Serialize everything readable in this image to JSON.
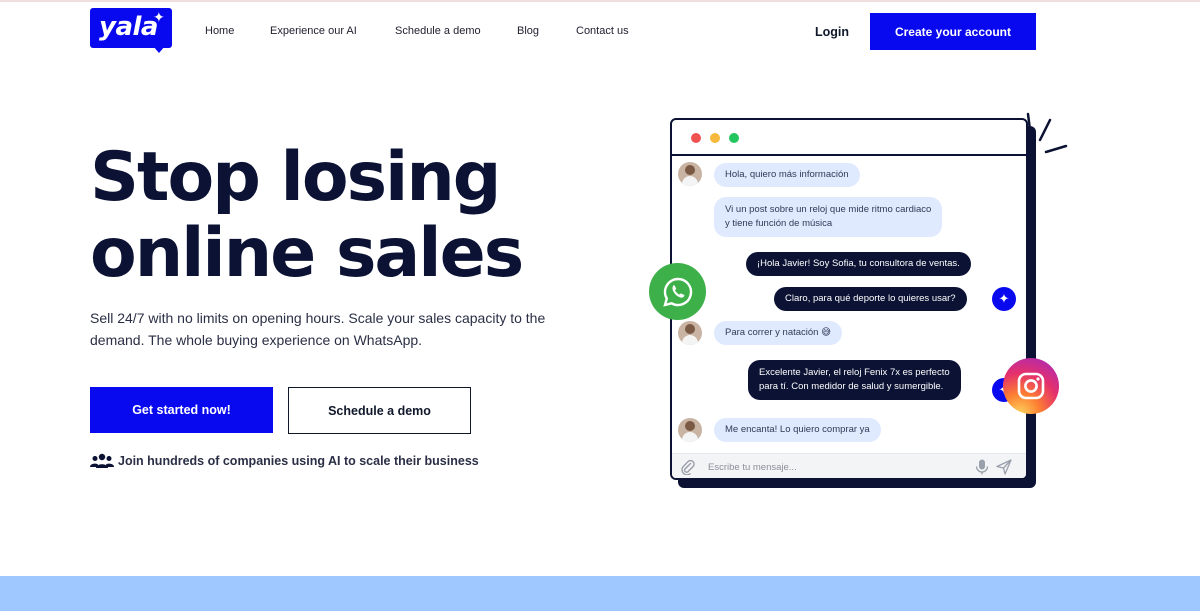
{
  "brand": {
    "logo_text": "yala",
    "accent": "#0909EF",
    "dark": "#0B1233"
  },
  "nav": {
    "links": [
      "Home",
      "Experience our AI",
      "Schedule a demo",
      "Blog",
      "Contact us"
    ],
    "login": "Login",
    "create_account": "Create your account"
  },
  "hero": {
    "title_line1": "Stop losing",
    "title_line2": "online sales",
    "subtitle": "Sell 24/7 with no limits on opening hours. Scale your sales capacity to the demand. The whole buying experience on WhatsApp.",
    "cta_primary": "Get started now!",
    "cta_secondary": "Schedule a demo",
    "social_proof": "Join hundreds of companies using AI to scale their business"
  },
  "chat": {
    "messages": [
      {
        "from": "user",
        "text": "Hola, quiero más información"
      },
      {
        "from": "user",
        "text": "Vi un post sobre un reloj que mide ritmo cardiaco\ny tiene función de música"
      },
      {
        "from": "bot",
        "text": "¡Hola Javier! Soy Sofia, tu consultora de ventas."
      },
      {
        "from": "bot",
        "text": "Claro, para qué deporte lo quieres usar?"
      },
      {
        "from": "user",
        "text": "Para correr y natación 😅"
      },
      {
        "from": "bot",
        "text": "Excelente Javier, el reloj Fenix 7x es perfecto\npara tí. Con medidor de salud y sumergible."
      },
      {
        "from": "user",
        "text": "Me encanta! Lo quiero comprar ya"
      }
    ],
    "composer_placeholder": "Escribe tu mensaje...",
    "icons": [
      "paperclip-icon",
      "microphone-icon",
      "send-icon",
      "whatsapp-icon",
      "instagram-icon",
      "sparkle-icon"
    ]
  }
}
